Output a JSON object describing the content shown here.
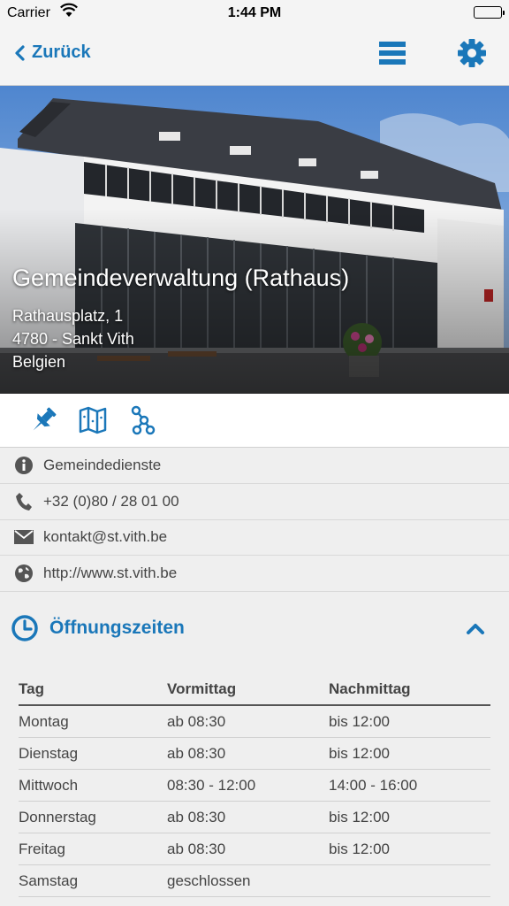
{
  "status": {
    "carrier": "Carrier",
    "time": "1:44 PM"
  },
  "nav": {
    "back_label": "Zurück"
  },
  "place": {
    "title": "Gemeindeverwaltung (Rathaus)",
    "address": [
      "Rathausplatz, 1",
      "4780 - Sankt Vith",
      "Belgien"
    ]
  },
  "info": {
    "category": "Gemeindedienste",
    "phone": "+32 (0)80 / 28 01 00",
    "email": "kontakt@st.vith.be",
    "website": "http://www.st.vith.be"
  },
  "hours": {
    "title": "Öffnungszeiten",
    "columns": [
      "Tag",
      "Vormittag",
      "Nachmittag"
    ],
    "rows": [
      [
        "Montag",
        "ab 08:30",
        "bis 12:00"
      ],
      [
        "Dienstag",
        "ab 08:30",
        "bis 12:00"
      ],
      [
        "Mittwoch",
        "08:30 - 12:00",
        "14:00 - 16:00"
      ],
      [
        "Donnerstag",
        "ab 08:30",
        "bis 12:00"
      ],
      [
        "Freitag",
        "ab 08:30",
        "bis 12:00"
      ],
      [
        "Samstag",
        "geschlossen",
        ""
      ]
    ]
  },
  "colors": {
    "accent": "#1a77b9"
  }
}
